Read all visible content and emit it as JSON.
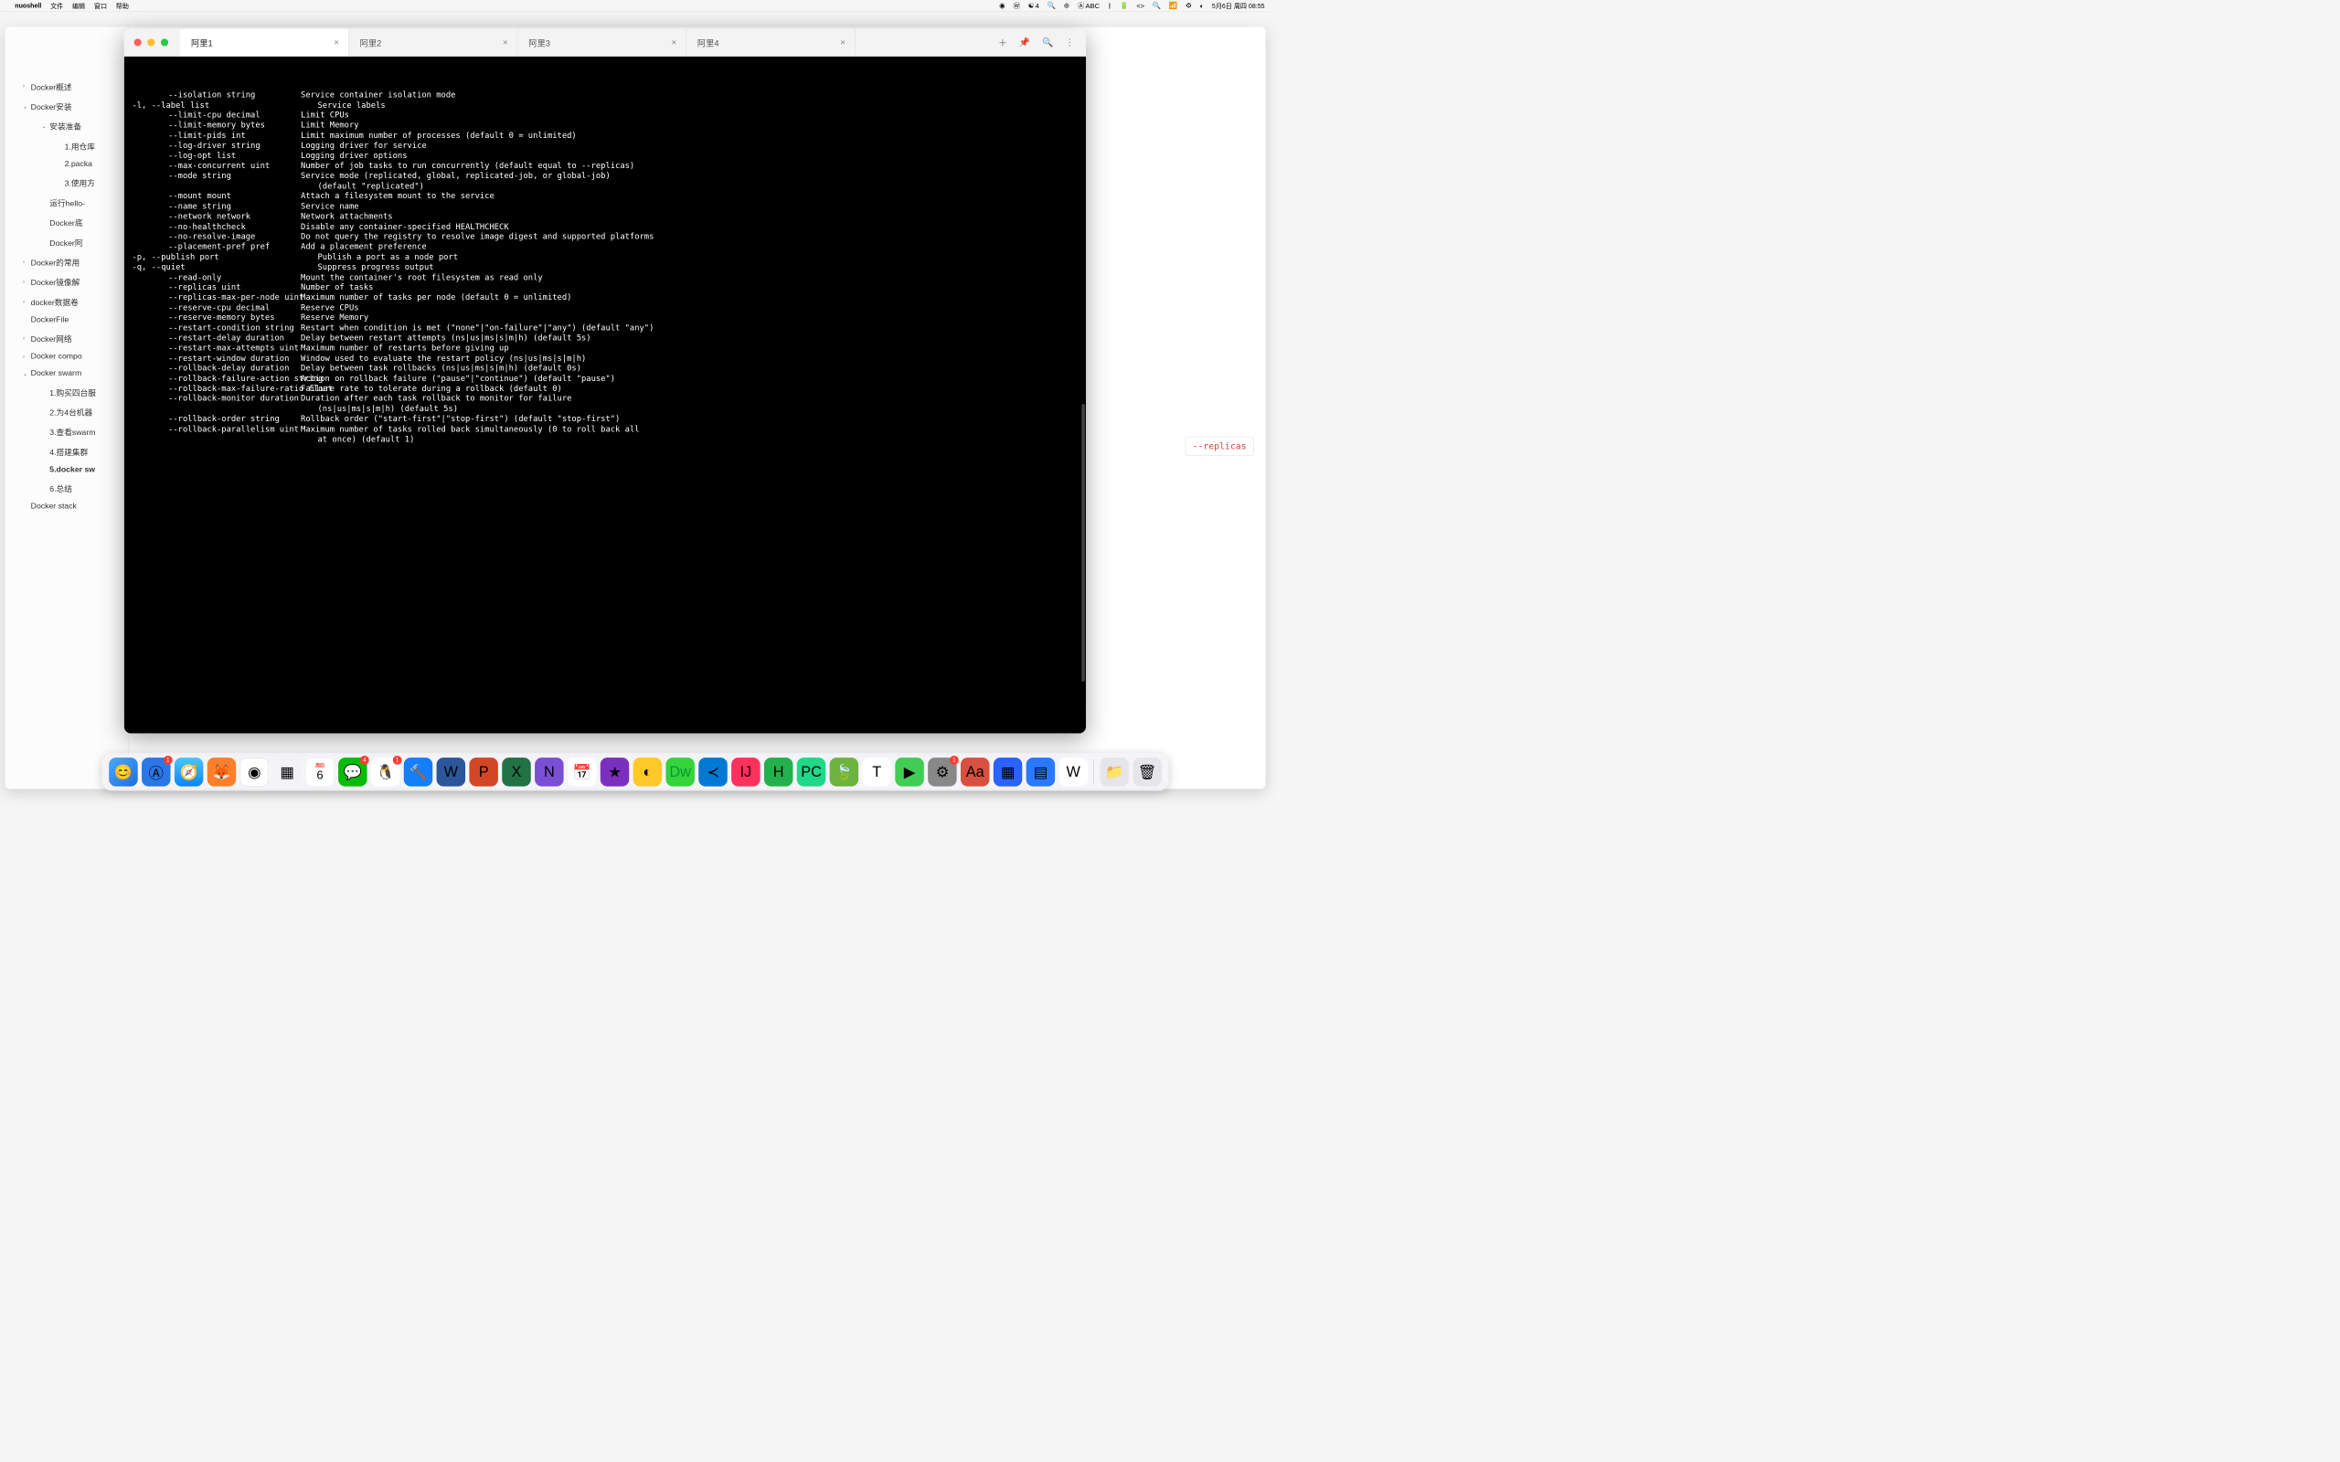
{
  "menubar": {
    "app": "nuoshell",
    "items": [
      "文件",
      "编辑",
      "窗口",
      "帮助"
    ],
    "right": {
      "wechat_count": "4",
      "input_label": "ABC",
      "clock": "5月6日 周四 08:55"
    }
  },
  "bg": {
    "replicas_hint": "--replicas"
  },
  "sidebar": {
    "items": [
      {
        "label": "Docker概述",
        "lvl": 1,
        "chev": ">"
      },
      {
        "label": "Docker安装",
        "lvl": 1,
        "chev": "v"
      },
      {
        "label": "安装准备",
        "lvl": 2,
        "chev": "v"
      },
      {
        "label": "1.用仓库",
        "lvl": 3,
        "chev": ""
      },
      {
        "label": "2.packa",
        "lvl": 3,
        "chev": ""
      },
      {
        "label": "3.使用方",
        "lvl": 3,
        "chev": ""
      },
      {
        "label": "运行hello-",
        "lvl": 2,
        "chev": ""
      },
      {
        "label": "Docker底",
        "lvl": 2,
        "chev": ""
      },
      {
        "label": "Docker阿",
        "lvl": 2,
        "chev": ""
      },
      {
        "label": "Docker的常用",
        "lvl": 1,
        "chev": ">"
      },
      {
        "label": "Docker镜像解",
        "lvl": 1,
        "chev": ">"
      },
      {
        "label": "docker数据卷",
        "lvl": 1,
        "chev": ">"
      },
      {
        "label": "DockerFile",
        "lvl": 1,
        "chev": ""
      },
      {
        "label": "Docker网络",
        "lvl": 1,
        "chev": ">"
      },
      {
        "label": "Docker compo",
        "lvl": 1,
        "chev": ">"
      },
      {
        "label": "Docker swarm",
        "lvl": 1,
        "chev": "v"
      },
      {
        "label": "1.购买四台服",
        "lvl": 2,
        "chev": ""
      },
      {
        "label": "2.为4台机器",
        "lvl": 2,
        "chev": ""
      },
      {
        "label": "3.查看swarm",
        "lvl": 2,
        "chev": ""
      },
      {
        "label": "4.搭建集群",
        "lvl": 2,
        "chev": ""
      },
      {
        "label": "5.docker sw",
        "lvl": 2,
        "chev": "",
        "active": true
      },
      {
        "label": "6.总结",
        "lvl": 2,
        "chev": ""
      },
      {
        "label": "Docker stack",
        "lvl": 1,
        "chev": ""
      }
    ]
  },
  "terminal": {
    "tabs": [
      {
        "label": "阿里1",
        "active": true
      },
      {
        "label": "阿里2"
      },
      {
        "label": "阿里3"
      },
      {
        "label": "阿里4"
      }
    ],
    "rows": [
      {
        "opt": "    --isolation string",
        "desc": "Service container isolation mode"
      },
      {
        "opt": "-l, --label list",
        "desc": "Service labels",
        "short": true
      },
      {
        "opt": "    --limit-cpu decimal",
        "desc": "Limit CPUs"
      },
      {
        "opt": "    --limit-memory bytes",
        "desc": "Limit Memory"
      },
      {
        "opt": "    --limit-pids int",
        "desc": "Limit maximum number of processes (default 0 = unlimited)"
      },
      {
        "opt": "    --log-driver string",
        "desc": "Logging driver for service"
      },
      {
        "opt": "    --log-opt list",
        "desc": "Logging driver options"
      },
      {
        "opt": "    --max-concurrent uint",
        "desc": "Number of job tasks to run concurrently (default equal to --replicas)"
      },
      {
        "opt": "    --mode string",
        "desc": "Service mode (replicated, global, replicated-job, or global-job)"
      },
      {
        "cont": "(default \"replicated\")"
      },
      {
        "opt": "    --mount mount",
        "desc": "Attach a filesystem mount to the service"
      },
      {
        "opt": "    --name string",
        "desc": "Service name"
      },
      {
        "opt": "    --network network",
        "desc": "Network attachments"
      },
      {
        "opt": "    --no-healthcheck",
        "desc": "Disable any container-specified HEALTHCHECK"
      },
      {
        "opt": "    --no-resolve-image",
        "desc": "Do not query the registry to resolve image digest and supported platforms"
      },
      {
        "opt": "    --placement-pref pref",
        "desc": "Add a placement preference"
      },
      {
        "opt": "-p, --publish port",
        "desc": "Publish a port as a node port",
        "short": true
      },
      {
        "opt": "-q, --quiet",
        "desc": "Suppress progress output",
        "short": true
      },
      {
        "opt": "    --read-only",
        "desc": "Mount the container's root filesystem as read only"
      },
      {
        "opt": "    --replicas uint",
        "desc": "Number of tasks"
      },
      {
        "opt": "    --replicas-max-per-node uint",
        "desc": "Maximum number of tasks per node (default 0 = unlimited)"
      },
      {
        "opt": "    --reserve-cpu decimal",
        "desc": "Reserve CPUs"
      },
      {
        "opt": "    --reserve-memory bytes",
        "desc": "Reserve Memory"
      },
      {
        "opt": "    --restart-condition string",
        "desc": "Restart when condition is met (\"none\"|\"on-failure\"|\"any\") (default \"any\")"
      },
      {
        "opt": "    --restart-delay duration",
        "desc": "Delay between restart attempts (ns|us|ms|s|m|h) (default 5s)"
      },
      {
        "opt": "    --restart-max-attempts uint",
        "desc": "Maximum number of restarts before giving up"
      },
      {
        "opt": "    --restart-window duration",
        "desc": "Window used to evaluate the restart policy (ns|us|ms|s|m|h)"
      },
      {
        "opt": "    --rollback-delay duration",
        "desc": "Delay between task rollbacks (ns|us|ms|s|m|h) (default 0s)"
      },
      {
        "opt": "    --rollback-failure-action string",
        "desc": "Action on rollback failure (\"pause\"|\"continue\") (default \"pause\")"
      },
      {
        "opt": "    --rollback-max-failure-ratio float",
        "desc": "Failure rate to tolerate during a rollback (default 0)"
      },
      {
        "opt": "    --rollback-monitor duration",
        "desc": "Duration after each task rollback to monitor for failure"
      },
      {
        "cont": "(ns|us|ms|s|m|h) (default 5s)"
      },
      {
        "opt": "    --rollback-order string",
        "desc": "Rollback order (\"start-first\"|\"stop-first\") (default \"stop-first\")"
      },
      {
        "opt": "    --rollback-parallelism uint",
        "desc": "Maximum number of tasks rolled back simultaneously (0 to roll back all"
      },
      {
        "cont": "at once) (default 1)"
      }
    ]
  },
  "dock": {
    "calendar_day": "6",
    "calendar_wk": "周四",
    "wechat_badge": "4",
    "qq_badge": "1",
    "appstore_badge": "1",
    "gear_badge": "1"
  }
}
